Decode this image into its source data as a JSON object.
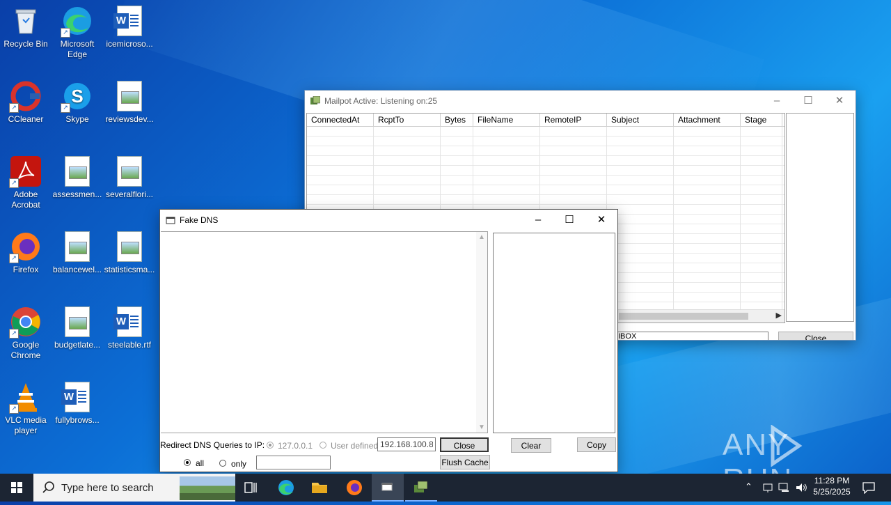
{
  "desktop": {
    "icons": [
      {
        "label": "Recycle Bin"
      },
      {
        "label": "Microsoft Edge"
      },
      {
        "label": "icemicroso..."
      },
      {
        "label": "CCleaner"
      },
      {
        "label": "Skype"
      },
      {
        "label": "reviewsdev..."
      },
      {
        "label": "Adobe Acrobat"
      },
      {
        "label": "assessmen..."
      },
      {
        "label": "severalflori..."
      },
      {
        "label": "Firefox"
      },
      {
        "label": "balancewel..."
      },
      {
        "label": "statisticsma..."
      },
      {
        "label": "Google Chrome"
      },
      {
        "label": "budgetlate..."
      },
      {
        "label": "steelable.rtf"
      },
      {
        "label": "VLC media player"
      },
      {
        "label": "fullybrows..."
      }
    ]
  },
  "mailpot": {
    "title": "Mailpot Active: Listening on:25",
    "columns": [
      "ConnectedAt",
      "RcptTo",
      "Bytes",
      "FileName",
      "RemoteIP",
      "Subject",
      "Attachment",
      "Stage"
    ],
    "status_text": "IBOX",
    "close_label": "Close"
  },
  "fakedns": {
    "title": "Fake DNS",
    "redirect_label": "Redirect DNS Queries to IP:",
    "radio_local": "127.0.0.1",
    "radio_user": "User defined",
    "ip_value": "192.168.100.8",
    "close_label": "Close",
    "clear_label": "Clear",
    "copy_label": "Copy",
    "flush_label": "Flush Cache",
    "radio_all": "all",
    "radio_only": "only",
    "only_value": ""
  },
  "taskbar": {
    "search_placeholder": "Type here to search",
    "time": "11:28 PM",
    "date": "5/25/2025"
  },
  "watermark": "ANY RUN"
}
